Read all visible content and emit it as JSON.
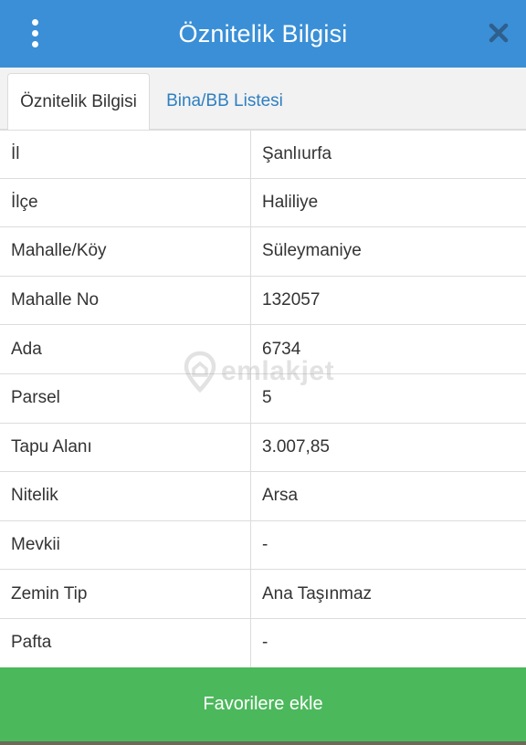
{
  "header": {
    "title": "Öznitelik Bilgisi",
    "menu_icon": "kebab-menu-icon",
    "close_icon": "close-icon"
  },
  "tabs": [
    {
      "label": "Öznitelik Bilgisi",
      "active": true
    },
    {
      "label": "Bina/BB Listesi",
      "active": false
    }
  ],
  "rows": [
    {
      "label": "İl",
      "value": "Şanlıurfa"
    },
    {
      "label": "İlçe",
      "value": "Haliliye"
    },
    {
      "label": "Mahalle/Köy",
      "value": "Süleymaniye"
    },
    {
      "label": "Mahalle No",
      "value": "132057"
    },
    {
      "label": "Ada",
      "value": "6734"
    },
    {
      "label": "Parsel",
      "value": "5"
    },
    {
      "label": "Tapu Alanı",
      "value": "3.007,85"
    },
    {
      "label": "Nitelik",
      "value": "Arsa"
    },
    {
      "label": "Mevkii",
      "value": "-"
    },
    {
      "label": "Zemin Tip",
      "value": "Ana Taşınmaz"
    },
    {
      "label": "Pafta",
      "value": "-"
    }
  ],
  "watermark": {
    "text": "emlakjet",
    "icon": "location-pin-icon"
  },
  "favorite_button": {
    "label": "Favorilere ekle"
  },
  "colors": {
    "header_bg": "#3a8fd6",
    "tab_link": "#2d7fc1",
    "button_green": "#4cb85c",
    "border": "#dcdcdc"
  }
}
